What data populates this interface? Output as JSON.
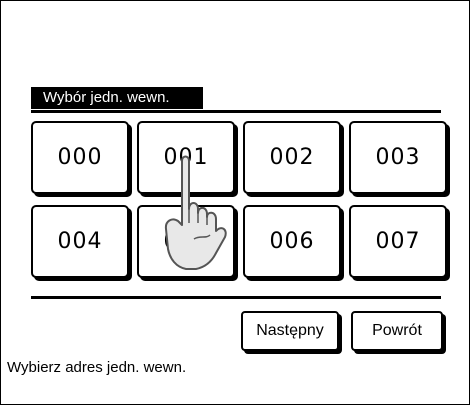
{
  "screen": {
    "title": "Wybór jedn. wewn.",
    "status_text": "Wybierz adres jedn. wewn."
  },
  "units": [
    {
      "label": "000"
    },
    {
      "label": "001"
    },
    {
      "label": "002"
    },
    {
      "label": "003"
    },
    {
      "label": "004"
    },
    {
      "label": "005"
    },
    {
      "label": "006"
    },
    {
      "label": "007"
    }
  ],
  "buttons": {
    "next_label": "Następny",
    "back_label": "Powrót"
  },
  "icons": {
    "pointer": "pointing-hand-icon"
  }
}
